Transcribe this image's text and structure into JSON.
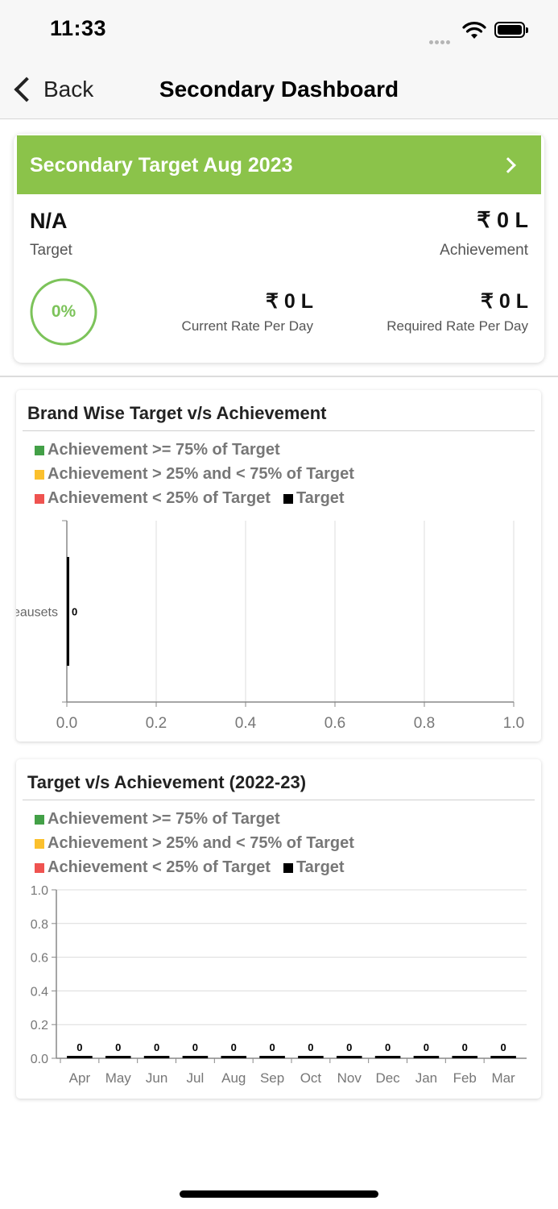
{
  "status_bar": {
    "time": "11:33"
  },
  "nav": {
    "back_label": "Back",
    "title": "Secondary Dashboard"
  },
  "target_card": {
    "header": "Secondary Target Aug 2023",
    "target_value": "N/A",
    "target_label": "Target",
    "achievement_value": "₹ 0 L",
    "achievement_label": "Achievement",
    "progress_text": "0%",
    "progress_fraction": 0,
    "current_rate_value": "₹ 0 L",
    "current_rate_label": "Current Rate Per Day",
    "required_rate_value": "₹ 0 L",
    "required_rate_label": "Required Rate Per Day"
  },
  "colors": {
    "header_green": "#8bc34a",
    "ring_green": "#7cc35a",
    "legend_green": "#43a047",
    "legend_yellow": "#fbc02d",
    "legend_red": "#ef5350",
    "legend_black": "#000000"
  },
  "legend": {
    "high": "Achievement >= 75% of Target",
    "mid": "Achievement > 25% and < 75% of Target",
    "low": "Achievement < 25% of Target",
    "target": "Target"
  },
  "brand_chart": {
    "title": "Brand Wise Target v/s Achievement"
  },
  "monthly_chart": {
    "title": "Target v/s Achievement (2022-23)"
  },
  "chart_data": [
    {
      "type": "bar",
      "orientation": "horizontal",
      "title": "Brand Wise Target v/s Achievement",
      "categories": [
        "eausets"
      ],
      "series": [
        {
          "name": "Target",
          "values": [
            0
          ]
        }
      ],
      "data_labels": [
        "0"
      ],
      "xlim": [
        0,
        1.0
      ],
      "x_ticks": [
        "0.0",
        "0.2",
        "0.4",
        "0.6",
        "0.8",
        "1.0"
      ],
      "grid": true,
      "legend_placement": "top-left"
    },
    {
      "type": "bar",
      "title": "Target v/s Achievement (2022-23)",
      "categories": [
        "Apr",
        "May",
        "Jun",
        "Jul",
        "Aug",
        "Sep",
        "Oct",
        "Nov",
        "Dec",
        "Jan",
        "Feb",
        "Mar"
      ],
      "series": [
        {
          "name": "Target",
          "values": [
            0,
            0,
            0,
            0,
            0,
            0,
            0,
            0,
            0,
            0,
            0,
            0
          ]
        }
      ],
      "data_labels": [
        "0",
        "0",
        "0",
        "0",
        "0",
        "0",
        "0",
        "0",
        "0",
        "0",
        "0",
        "0"
      ],
      "ylim": [
        0,
        1.0
      ],
      "y_ticks": [
        "0.0",
        "0.2",
        "0.4",
        "0.6",
        "0.8",
        "1.0"
      ],
      "grid": true,
      "legend_placement": "top-left"
    }
  ]
}
